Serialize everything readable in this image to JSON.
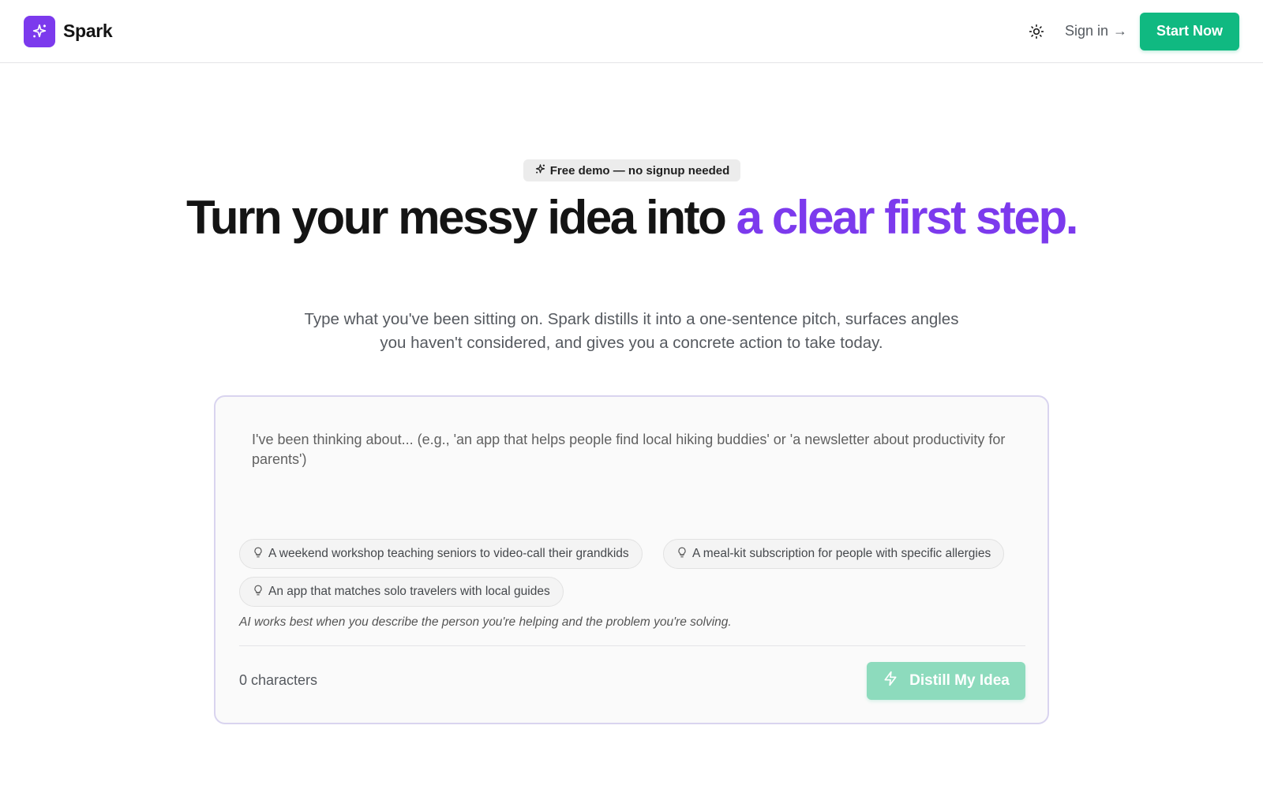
{
  "header": {
    "brand_name": "Spark",
    "sign_in_label": "Sign in",
    "sign_in_arrow": "→",
    "start_button_label": "Start Now"
  },
  "hero": {
    "badge_text": "Free demo — no signup needed",
    "headline_plain": "Turn your messy idea into ",
    "headline_accent": "a clear first step.",
    "subtitle": "Type what you've been sitting on. Spark distills it into a one-sentence pitch, surfaces angles you haven't considered, and gives you a concrete action to take today."
  },
  "composer": {
    "placeholder": "I've been thinking about... (e.g., 'an app that helps people find local hiking buddies' or 'a newsletter about productivity for parents')",
    "value": "",
    "suggestions": [
      "A weekend workshop teaching seniors to video-call their grandkids",
      "A meal-kit subscription for people with specific allergies",
      "An app that matches solo travelers with local guides"
    ],
    "hint": "AI works best when you describe the person you're helping and the problem you're solving.",
    "char_count": "0 characters",
    "submit_label": "Distill My Idea"
  },
  "colors": {
    "brand": "#7c3aed",
    "cta": "#10b981",
    "cta_disabled": "#8ddbbd"
  },
  "icons": {
    "logo": "sparkles-icon",
    "theme_toggle": "sun-icon",
    "badge": "sparkles-icon",
    "suggestion": "lightbulb-icon",
    "submit": "lightning-icon"
  }
}
